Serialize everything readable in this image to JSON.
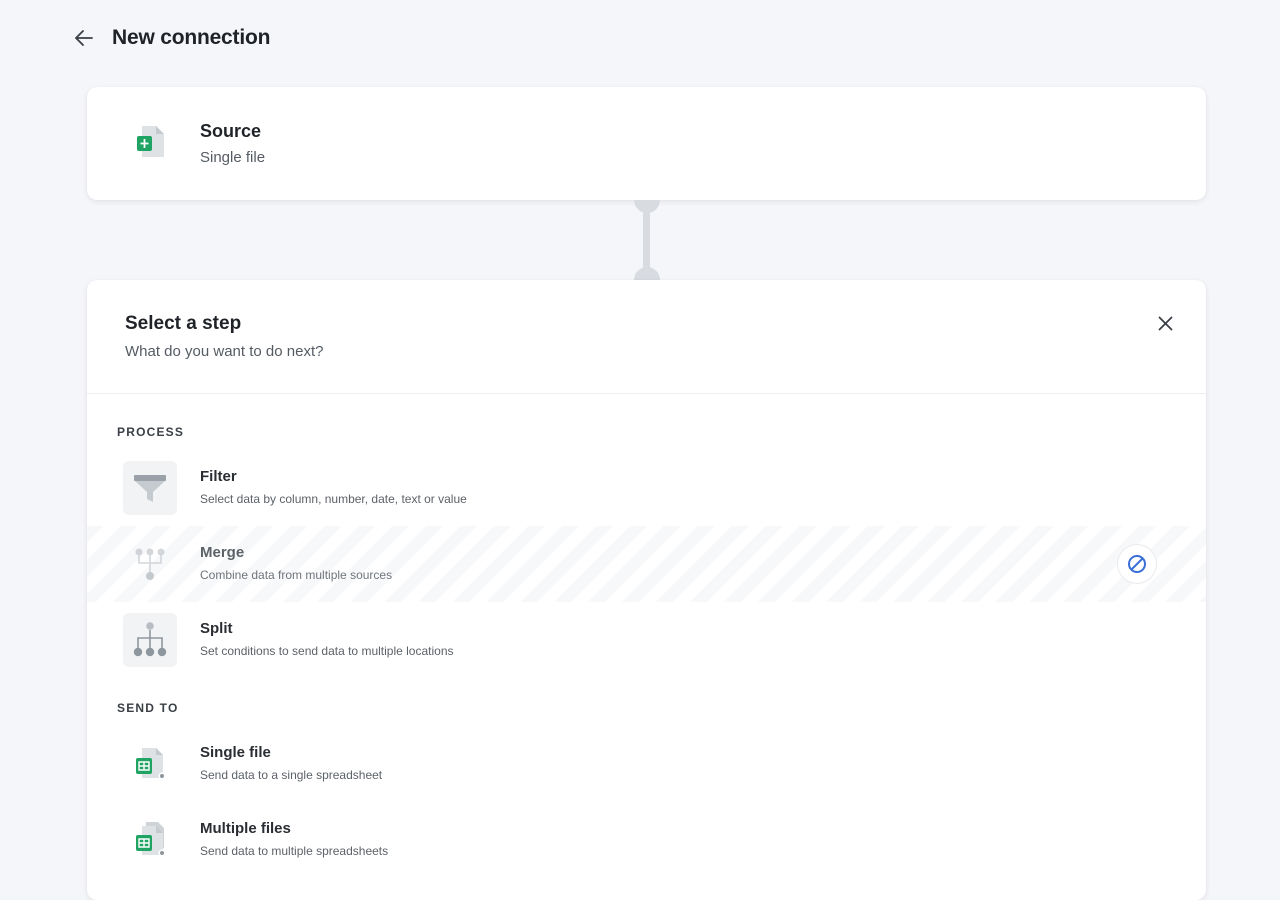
{
  "header": {
    "title": "New connection"
  },
  "source": {
    "title": "Source",
    "subtitle": "Single file",
    "icon": "spreadsheet-file-icon"
  },
  "step_picker": {
    "title": "Select a step",
    "subtitle": "What do you want to do next?",
    "sections": [
      {
        "label": "PROCESS",
        "items": [
          {
            "title": "Filter",
            "description": "Select data by column, number, date, text or value",
            "icon": "filter-icon",
            "disabled": false
          },
          {
            "title": "Merge",
            "description": "Combine data from multiple sources",
            "icon": "merge-icon",
            "disabled": true
          },
          {
            "title": "Split",
            "description": "Set conditions to send data to multiple locations",
            "icon": "split-icon",
            "disabled": false
          }
        ]
      },
      {
        "label": "SEND TO",
        "items": [
          {
            "title": "Single file",
            "description": "Send data to a single spreadsheet",
            "icon": "single-spreadsheet-icon",
            "disabled": false
          },
          {
            "title": "Multiple files",
            "description": "Send data to multiple spreadsheets",
            "icon": "multiple-spreadsheets-icon",
            "disabled": false
          }
        ]
      }
    ]
  },
  "colors": {
    "background": "#f5f6f9",
    "sheet_green": "#1fa463",
    "blocked_blue": "#3b6fd8",
    "icon_gray": "#a9b0b6"
  }
}
